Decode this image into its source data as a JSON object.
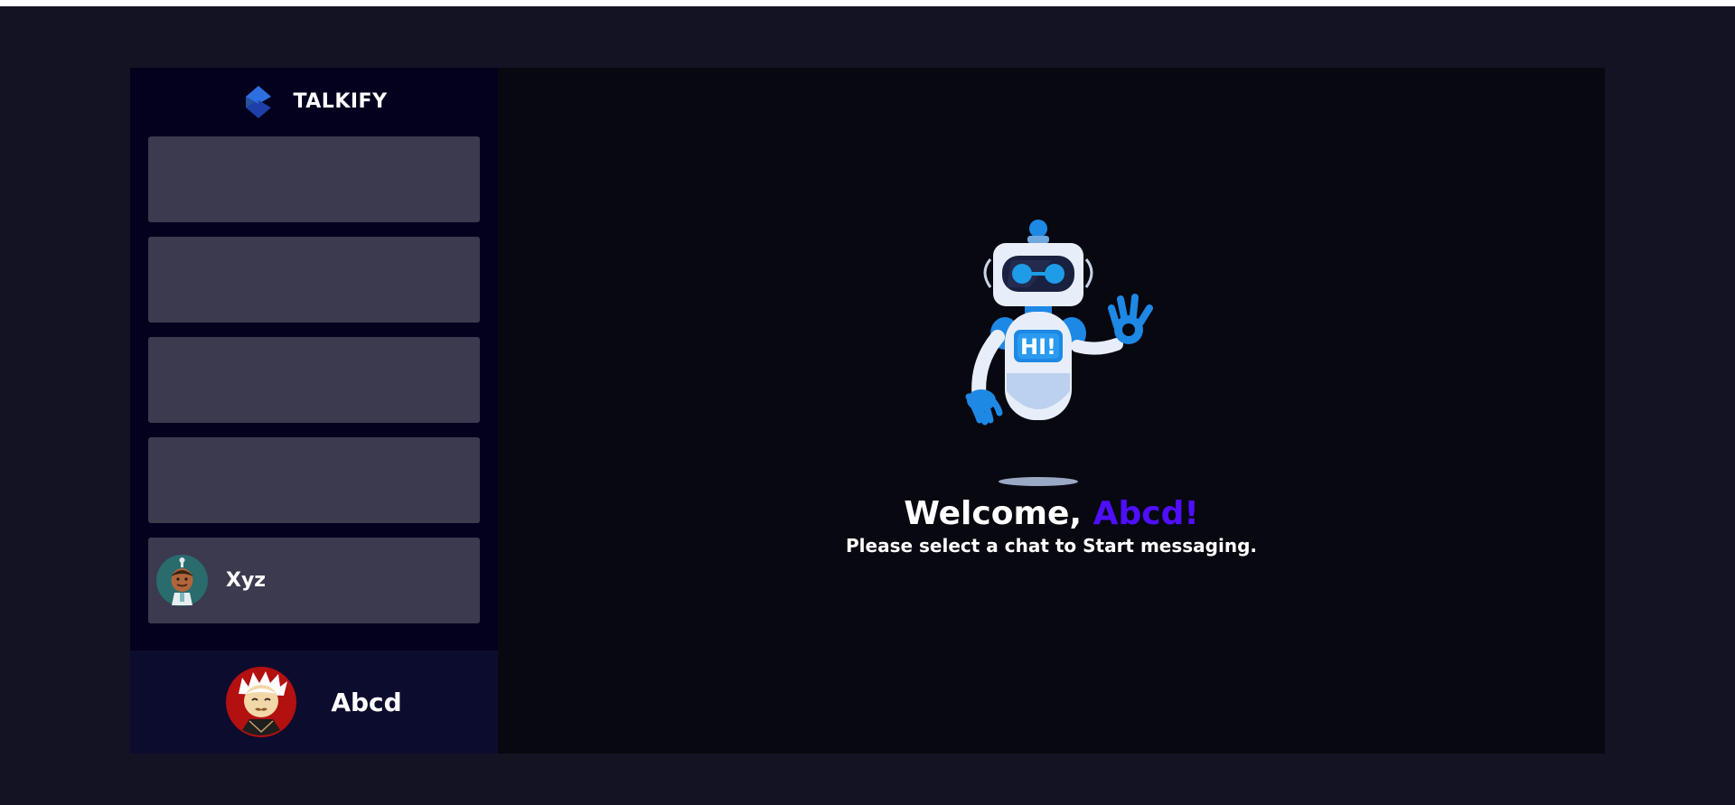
{
  "brand": {
    "name": "TALKIFY",
    "logo_icon": "diamond-logo-icon"
  },
  "contacts": [
    {
      "name": ""
    },
    {
      "name": ""
    },
    {
      "name": ""
    },
    {
      "name": ""
    },
    {
      "name": "Xyz"
    }
  ],
  "current_user": {
    "name": "Abcd"
  },
  "welcome": {
    "greeting": "Welcome, ",
    "username": "Abcd!",
    "subtitle": "Please select a chat to Start messaging.",
    "illustration_icon": "robot-waving-icon",
    "badge_text": "HI!"
  },
  "colors": {
    "page_bg": "#131324",
    "sidebar_bg": "#04011f",
    "contact_bg": "#3c3a4f",
    "user_panel_bg": "#0c0c2e",
    "chat_bg": "#080811",
    "accent": "#4e0eff"
  }
}
